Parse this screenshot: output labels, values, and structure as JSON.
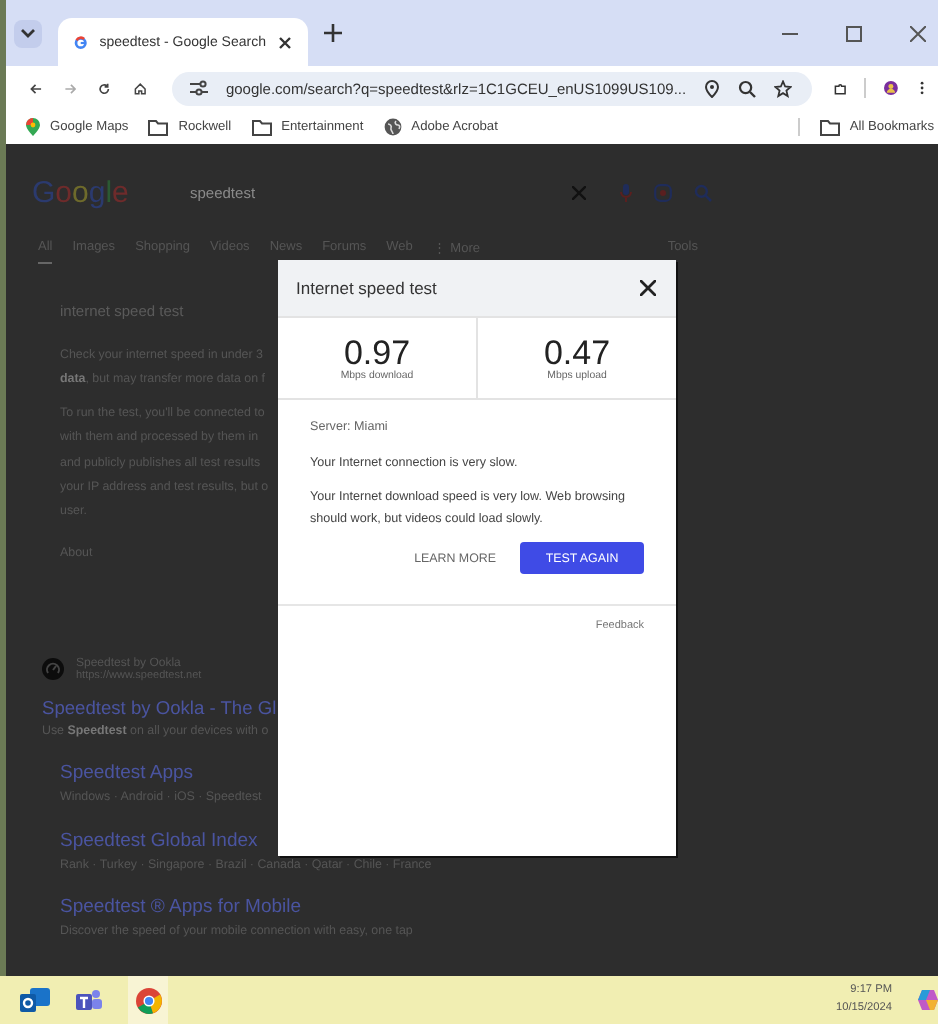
{
  "browser": {
    "tab_title": "speedtest - Google Search",
    "address": "google.com/search?q=speedtest&rlz=1C1GCEU_enUS1099US109...",
    "bookmarks": [
      {
        "kind": "maps",
        "label": "Google Maps"
      },
      {
        "kind": "folder",
        "label": "Rockwell"
      },
      {
        "kind": "folder",
        "label": "Entertainment"
      },
      {
        "kind": "globe",
        "label": "Adobe Acrobat"
      }
    ],
    "all_bookmarks": "All Bookmarks"
  },
  "page": {
    "logo": "Google",
    "search_query": "speedtest",
    "search_tabs": [
      {
        "label": "All",
        "selected": true
      },
      {
        "label": "Images",
        "selected": false
      },
      {
        "label": "Shopping",
        "selected": false
      },
      {
        "label": "Videos",
        "selected": false
      },
      {
        "label": "News",
        "selected": false
      },
      {
        "label": "Forums",
        "selected": false
      },
      {
        "label": "Web",
        "selected": false
      },
      {
        "label": "⋮ More",
        "selected": false
      }
    ],
    "tools": "Tools",
    "snippet_title": "internet speed test",
    "snippet_lines": [
      "Check your internet speed in under 3",
      "**data**, but may transfer more data on f"
    ],
    "about_lines": [
      "To run the test, you'll be connected to",
      "with them and processed by them in",
      "and publicly publishes all test results",
      "your IP address and test results, but o",
      "user."
    ],
    "about_link": "About",
    "result": {
      "site": "Speedtest by Ookla",
      "url": "https://www.speedtest.net",
      "title": "Speedtest by Ookla - The Gl",
      "description": "Use **Speedtest** on all your devices with o",
      "sublinks": [
        {
          "title": "Speedtest Apps",
          "text": "Windows · Android · iOS · Speedtest"
        },
        {
          "title": "Speedtest Global Index",
          "text": "Rank · Turkey · Singapore · Brazil · Canada · Qatar · Chile · France"
        },
        {
          "title": "Speedtest ® Apps for Mobile",
          "text": "Discover the speed of your mobile connection with easy, one tap"
        }
      ]
    }
  },
  "dialog": {
    "title": "Internet speed test",
    "download": {
      "value": "0.97",
      "unit": "Mbps download"
    },
    "upload": {
      "value": "0.47",
      "unit": "Mbps upload"
    },
    "server": "Server: Miami",
    "status": "Your Internet connection is very slow.",
    "message": "Your Internet download speed is very low. Web browsing should work, but videos could load slowly.",
    "learn_more": "LEARN MORE",
    "test_again": "TEST AGAIN",
    "feedback": "Feedback"
  },
  "taskbar": {
    "time": "9:17 PM",
    "date": "10/15/2024"
  }
}
